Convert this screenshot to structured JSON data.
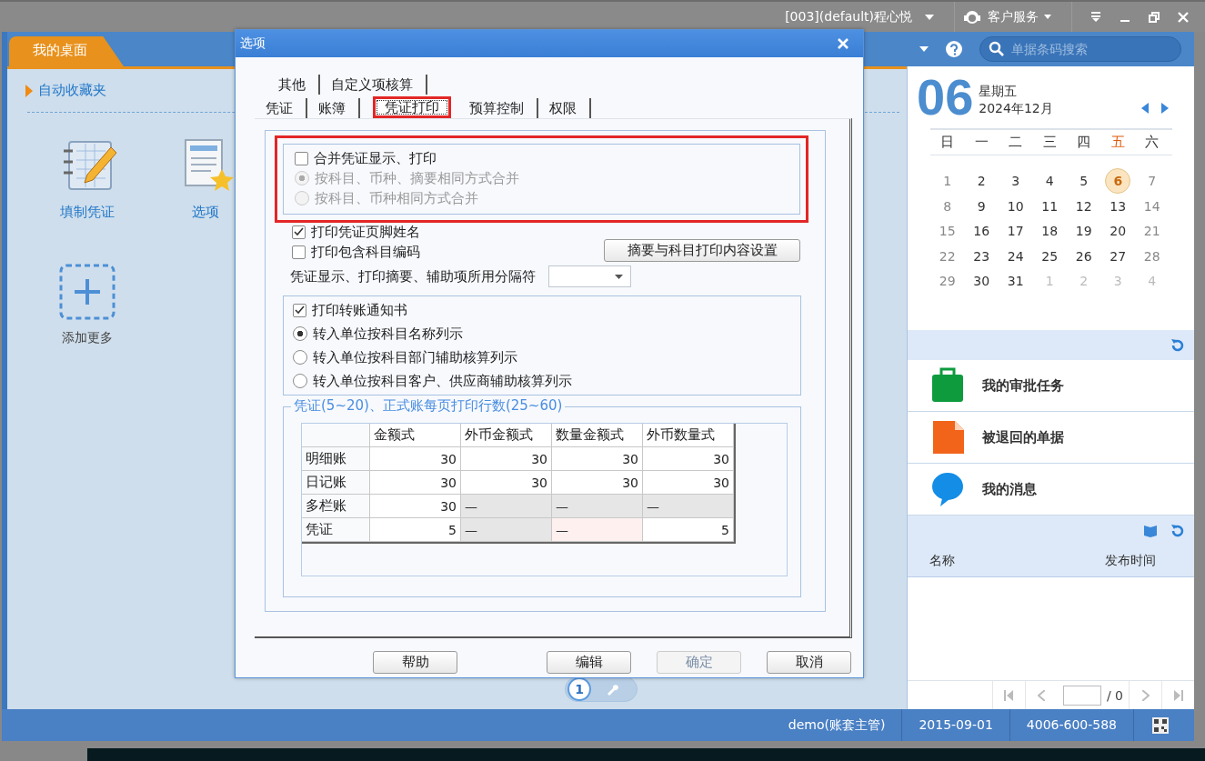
{
  "top_bar": {
    "user": "[003](default)程心悦",
    "service": "客户服务"
  },
  "header": {
    "tab": "我的桌面",
    "search": {
      "placeholder": "单据条码搜索"
    }
  },
  "desktop": {
    "section": "自动收藏夹",
    "shortcuts": [
      {
        "label": "填制凭证",
        "kind": "voucher"
      },
      {
        "label": "选项",
        "kind": "options"
      },
      {
        "label": "添加更多",
        "kind": "add"
      }
    ],
    "pages": [
      {
        "label": "1",
        "kind": "number",
        "selected": true
      },
      {
        "kind": "tool",
        "selected": false
      }
    ]
  },
  "calendar": {
    "day": "06",
    "weekday": "星期五",
    "month": "2024年12月",
    "weekdays": [
      {
        "label": "日",
        "selected": false
      },
      {
        "label": "一",
        "selected": false
      },
      {
        "label": "二",
        "selected": false
      },
      {
        "label": "三",
        "selected": false
      },
      {
        "label": "四",
        "selected": false
      },
      {
        "label": "五",
        "selected": true
      },
      {
        "label": "六",
        "selected": false
      }
    ],
    "days": [
      {
        "label": "1",
        "kind": "current",
        "selected": false
      },
      {
        "label": "2",
        "kind": "current",
        "selected": false
      },
      {
        "label": "3",
        "kind": "current",
        "selected": false
      },
      {
        "label": "4",
        "kind": "current",
        "selected": false
      },
      {
        "label": "5",
        "kind": "current",
        "selected": false
      },
      {
        "label": "6",
        "kind": "current",
        "selected": true
      },
      {
        "label": "7",
        "kind": "current",
        "selected": false
      },
      {
        "label": "8",
        "kind": "current",
        "selected": false
      },
      {
        "label": "9",
        "kind": "current",
        "selected": false
      },
      {
        "label": "10",
        "kind": "current",
        "selected": false
      },
      {
        "label": "11",
        "kind": "current",
        "selected": false
      },
      {
        "label": "12",
        "kind": "current",
        "selected": false
      },
      {
        "label": "13",
        "kind": "current",
        "selected": false
      },
      {
        "label": "14",
        "kind": "current",
        "selected": false
      },
      {
        "label": "15",
        "kind": "current",
        "selected": false
      },
      {
        "label": "16",
        "kind": "current",
        "selected": false
      },
      {
        "label": "17",
        "kind": "current",
        "selected": false
      },
      {
        "label": "18",
        "kind": "current",
        "selected": false
      },
      {
        "label": "19",
        "kind": "current",
        "selected": false
      },
      {
        "label": "20",
        "kind": "current",
        "selected": false
      },
      {
        "label": "21",
        "kind": "current",
        "selected": false
      },
      {
        "label": "22",
        "kind": "current",
        "selected": false
      },
      {
        "label": "23",
        "kind": "current",
        "selected": false
      },
      {
        "label": "24",
        "kind": "current",
        "selected": false
      },
      {
        "label": "25",
        "kind": "current",
        "selected": false
      },
      {
        "label": "26",
        "kind": "current",
        "selected": false
      },
      {
        "label": "27",
        "kind": "current",
        "selected": false
      },
      {
        "label": "28",
        "kind": "current",
        "selected": false
      },
      {
        "label": "29",
        "kind": "current",
        "selected": false
      },
      {
        "label": "30",
        "kind": "current",
        "selected": false
      },
      {
        "label": "31",
        "kind": "current",
        "selected": false
      },
      {
        "label": "1",
        "kind": "other",
        "selected": false
      },
      {
        "label": "2",
        "kind": "other",
        "selected": false
      },
      {
        "label": "3",
        "kind": "other",
        "selected": false
      },
      {
        "label": "4",
        "kind": "other",
        "selected": false
      }
    ]
  },
  "tasks": [
    {
      "label": "我的审批任务",
      "kind": "approval"
    },
    {
      "label": "被退回的单据",
      "kind": "returned"
    },
    {
      "label": "我的消息",
      "kind": "message"
    }
  ],
  "notices": {
    "columns": [
      "名称",
      "发布时间"
    ],
    "page_total": "/ 0"
  },
  "status_bar": [
    "demo(账套主管)",
    "2015-09-01",
    "4006-600-588"
  ],
  "dialog": {
    "title": "选项",
    "tab_rows": [
      [
        {
          "label": "其他",
          "selected": false,
          "highlighted": false
        },
        {
          "label": "自定义项核算",
          "selected": false,
          "highlighted": false
        }
      ],
      [
        {
          "label": "凭证",
          "selected": false,
          "highlighted": false
        },
        {
          "label": "账簿",
          "selected": false,
          "highlighted": false
        },
        {
          "label": "凭证打印",
          "selected": true,
          "highlighted": true
        },
        {
          "label": "预算控制",
          "selected": false,
          "highlighted": false
        },
        {
          "label": "权限",
          "selected": false,
          "highlighted": false
        }
      ]
    ],
    "merge_group": {
      "highlighted": true,
      "items": [
        {
          "kind": "checkbox",
          "label": "合并凭证显示、打印",
          "checked": false,
          "disabled": false
        },
        {
          "kind": "radio",
          "label": "按科目、币种、摘要相同方式合并",
          "selected": true,
          "disabled": true
        },
        {
          "kind": "radio",
          "label": "按科目、币种相同方式合并",
          "selected": false,
          "disabled": true
        }
      ]
    },
    "options": [
      {
        "kind": "checkbox",
        "label": "打印凭证页脚姓名",
        "checked": true,
        "disabled": false
      },
      {
        "kind": "checkbox",
        "label": "打印包含科目编码",
        "checked": false,
        "disabled": false
      }
    ],
    "setup_button": "摘要与科目打印内容设置",
    "separator_label": "凭证显示、打印摘要、辅助项所用分隔符",
    "transfer_group": {
      "items": [
        {
          "kind": "checkbox",
          "label": "打印转账通知书",
          "checked": true,
          "disabled": false
        },
        {
          "kind": "radio",
          "label": "转入单位按科目名称列示",
          "selected": true,
          "disabled": false
        },
        {
          "kind": "radio",
          "label": "转入单位按科目部门辅助核算列示",
          "selected": false,
          "disabled": false
        },
        {
          "kind": "radio",
          "label": "转入单位按科目客户、供应商辅助核算列示",
          "selected": false,
          "disabled": false
        }
      ]
    },
    "lines_group": {
      "legend": "凭证(5~20)、正式账每页打印行数(25~60)",
      "columns": [
        "金额式",
        "外币金额式",
        "数量金额式",
        "外币数量式"
      ],
      "rows": [
        {
          "label": "明细账",
          "cells": [
            {
              "value": "30",
              "disabled": false,
              "focused": false
            },
            {
              "value": "30",
              "disabled": false,
              "focused": false
            },
            {
              "value": "30",
              "disabled": false,
              "focused": false
            },
            {
              "value": "30",
              "disabled": false,
              "focused": false
            }
          ]
        },
        {
          "label": "日记账",
          "cells": [
            {
              "value": "30",
              "disabled": false,
              "focused": false
            },
            {
              "value": "30",
              "disabled": false,
              "focused": false
            },
            {
              "value": "30",
              "disabled": false,
              "focused": false
            },
            {
              "value": "30",
              "disabled": false,
              "focused": false
            }
          ]
        },
        {
          "label": "多栏账",
          "cells": [
            {
              "value": "30",
              "disabled": false,
              "focused": false
            },
            {
              "value": "—",
              "disabled": true,
              "focused": false
            },
            {
              "value": "—",
              "disabled": true,
              "focused": false
            },
            {
              "value": "—",
              "disabled": true,
              "focused": false
            }
          ]
        },
        {
          "label": "凭证",
          "cells": [
            {
              "value": "5",
              "disabled": false,
              "focused": false
            },
            {
              "value": "—",
              "disabled": true,
              "focused": false
            },
            {
              "value": "—",
              "disabled": true,
              "focused": true
            },
            {
              "value": "5",
              "disabled": false,
              "focused": false
            }
          ]
        }
      ]
    },
    "buttons": [
      {
        "label": "帮助",
        "disabled": false
      },
      {
        "label": "编辑",
        "disabled": false
      },
      {
        "label": "确定",
        "disabled": true
      },
      {
        "label": "取消",
        "disabled": false
      }
    ]
  }
}
